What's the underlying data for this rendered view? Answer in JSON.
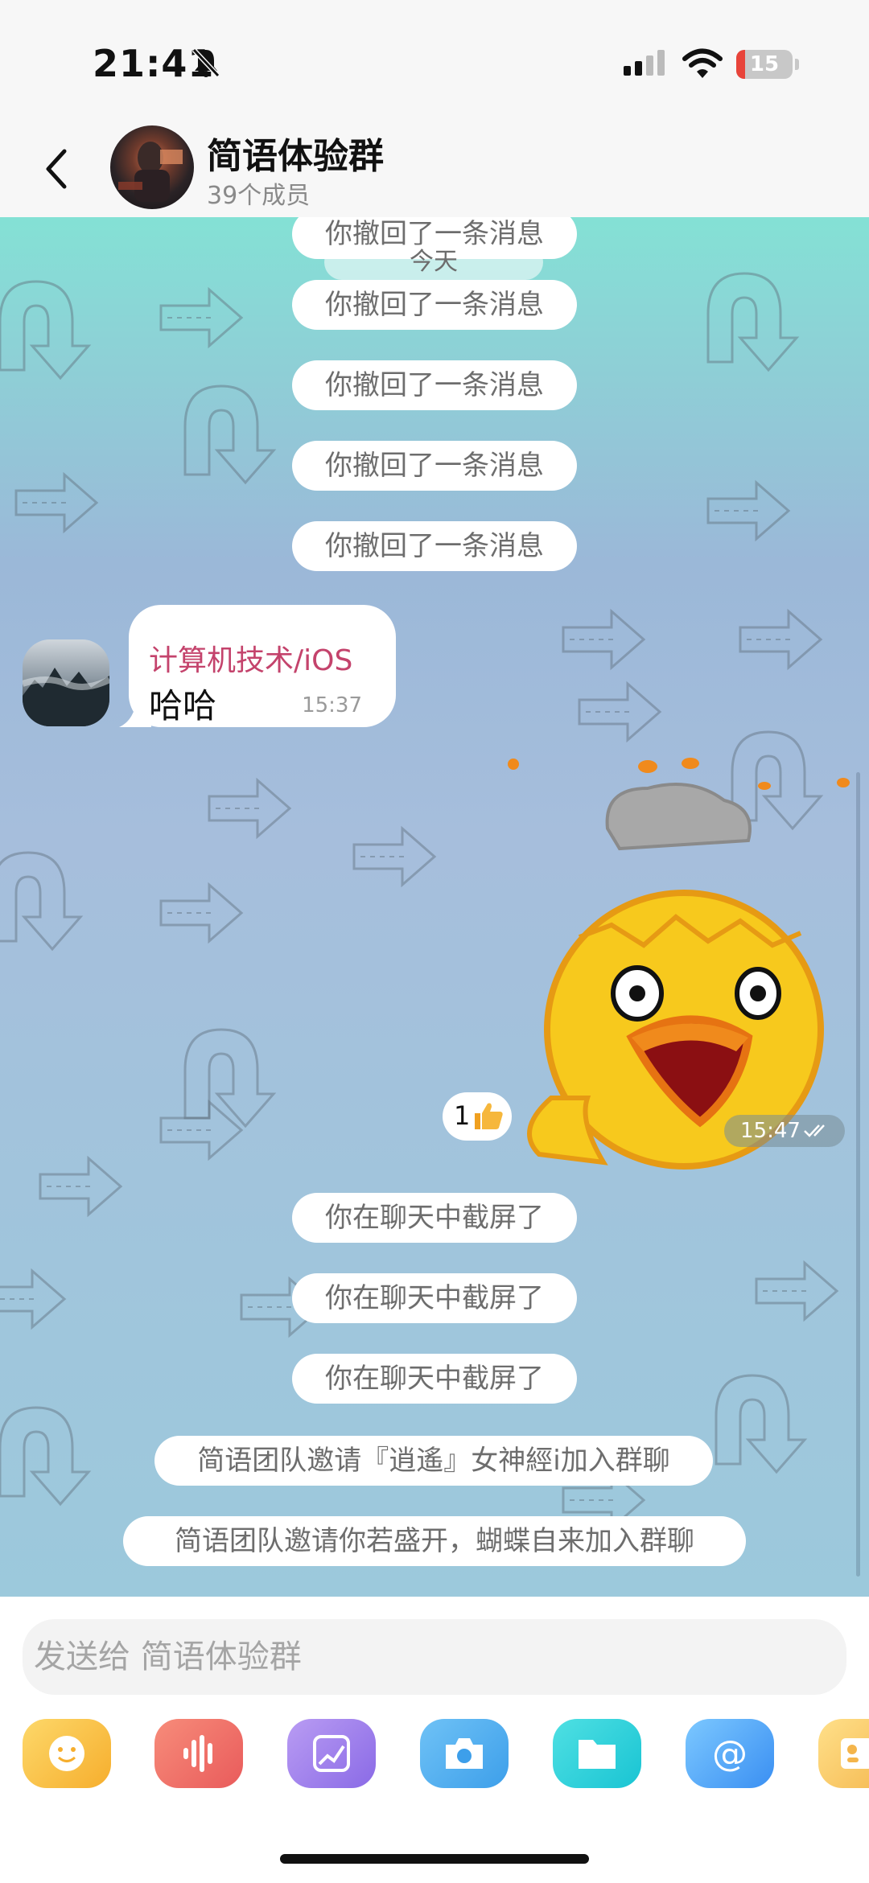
{
  "status_bar": {
    "time": "21:41",
    "battery": "15",
    "battery_level": 0.15
  },
  "header": {
    "title": "简语体验群",
    "subtitle": "39个成员"
  },
  "chat": {
    "date_label": "今天",
    "top_notice": "你撤回了一条消息",
    "recalled": [
      "你撤回了一条消息",
      "你撤回了一条消息",
      "你撤回了一条消息",
      "你撤回了一条消息"
    ],
    "message": {
      "sender": "计算机技术/iOS",
      "text": "哈哈",
      "time": "15:37"
    },
    "sticker": {
      "time": "15:47",
      "reaction_count": "1"
    },
    "screenshot_notices": [
      "你在聊天中截屏了",
      "你在聊天中截屏了",
      "你在聊天中截屏了"
    ],
    "invites": [
      "简语团队邀请『逍遙』女神經ⅰ加入群聊",
      "简语团队邀请你若盛开，蝴蝶自来加入群聊"
    ]
  },
  "input": {
    "placeholder": "发送给 简语体验群"
  },
  "tools": [
    "emoji-icon",
    "voice-icon",
    "image-icon",
    "camera-icon",
    "folder-icon",
    "mention-icon",
    "contact-icon"
  ]
}
